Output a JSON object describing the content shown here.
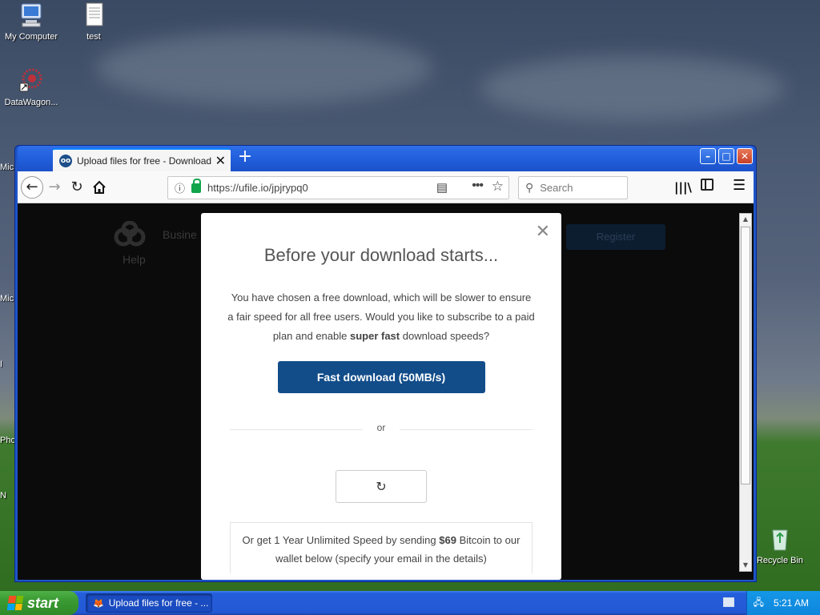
{
  "desktop": {
    "icons": [
      {
        "label": "My Computer",
        "icon": "my-computer-icon"
      },
      {
        "label": "test",
        "icon": "text-document-icon"
      },
      {
        "label": "DataWagon...",
        "icon": "datawagon-shortcut-icon"
      },
      {
        "label": "Recycle Bin",
        "icon": "recycle-bin-icon"
      }
    ],
    "edge_labels": [
      "Mic",
      "Mic",
      "I",
      "Pho",
      "N"
    ]
  },
  "browser": {
    "tab_title": "Upload files for free - Download.zi",
    "tab_close": "✕",
    "new_tab": "+",
    "window_buttons": {
      "minimize": "–",
      "maximize": "□",
      "close": "✕"
    },
    "url": "https://ufile.io/jpjrypq0",
    "search_placeholder": "Search"
  },
  "page": {
    "background": {
      "logo_help": "Help",
      "business": "Busine",
      "register": "Register"
    },
    "modal": {
      "close": "✕",
      "title": "Before your download starts...",
      "body_prefix": "You have chosen a free download, which will be slower to ensure a fair speed for all free users. Would you like to subscribe to a paid plan and enable ",
      "body_bold": "super fast",
      "body_suffix": " download speeds?",
      "fast_button": "Fast download (50MB/s)",
      "or": "or",
      "refresh_icon": "↻",
      "bitcoin_prefix": "Or get 1 Year Unlimited Speed by sending ",
      "bitcoin_amount": "$69",
      "bitcoin_suffix": " Bitcoin to our wallet below (specify your email in the details)"
    }
  },
  "taskbar": {
    "start_label": "start",
    "task_label": "Upload files for free - ...",
    "clock": "5:21 AM"
  },
  "colors": {
    "fast_button": "#124d8a",
    "titlebar": "#215fdc",
    "start_button": "#3a9a32"
  }
}
